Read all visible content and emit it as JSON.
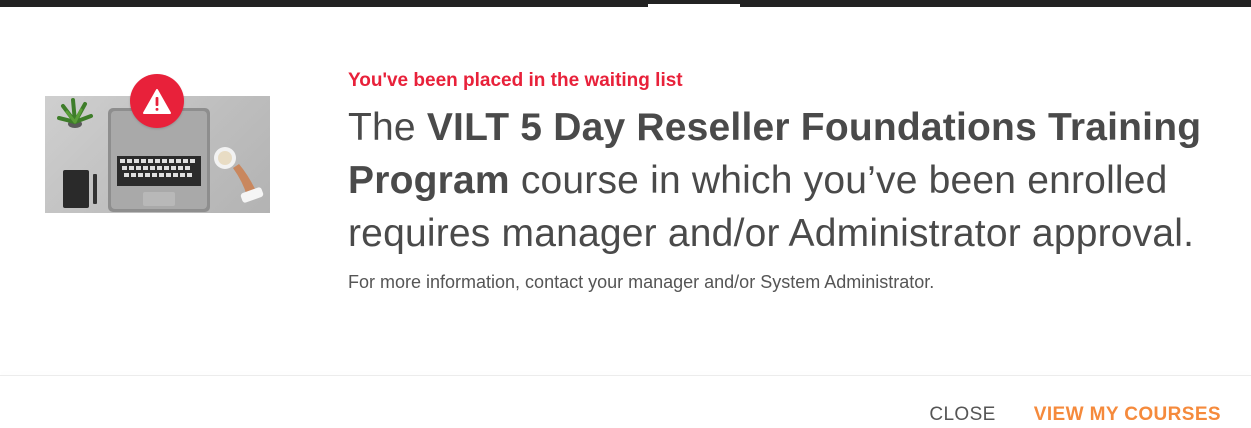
{
  "dialog": {
    "status_text": "You've been placed in the waiting list",
    "message": {
      "prefix": "The ",
      "course_name": "VILT 5 Day Reseller Foundations Training Program",
      "suffix": " course in which you’ve been enrolled requires manager and/or Administrator approval."
    },
    "note": "For more information, contact your manager and/or System Administrator.",
    "buttons": {
      "close_label": "CLOSE",
      "primary_label": "VIEW MY COURSES"
    }
  },
  "colors": {
    "alert_red": "#e8213a",
    "primary_orange": "#f58a3c",
    "text_dark": "#4a4a4a"
  },
  "icons": {
    "warning": "warning-triangle-icon"
  }
}
